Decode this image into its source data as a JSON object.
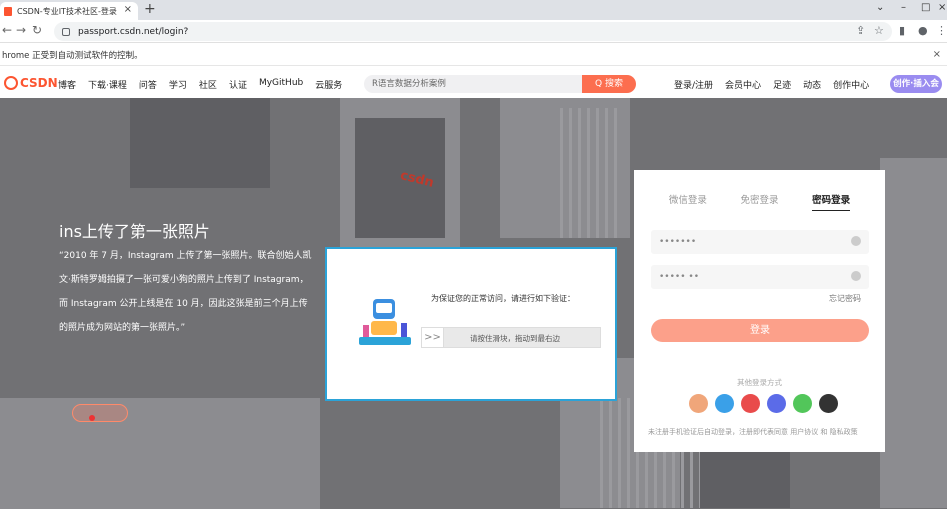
{
  "browser": {
    "tab_title": "CSDN-专业IT技术社区-登录",
    "tab_close": "×",
    "new_tab": "+",
    "url": "passport.csdn.net/login?",
    "infobar_text": "hrome 正受到自动测试软件的控制。",
    "infobar_close": "×"
  },
  "header": {
    "logo_text": "CSDN",
    "nav": [
      "博客",
      "下载·课程",
      "问答",
      "学习",
      "社区",
      "认证",
      "MyGitHub",
      "云服务"
    ],
    "search_placeholder": "R语言数据分析案例",
    "search_button": "Q 搜索",
    "right_links": [
      "登录/注册",
      "会员中心",
      "足迹",
      "动态",
      "创作中心"
    ],
    "create_button": "创作·插入会"
  },
  "hero": {
    "title": "ins上传了第一张照片",
    "paragraph": "“2010 年 7 月，Instagram 上传了第一张照片。联合创始人凯文·斯特罗姆拍摄了一张可爱小狗的照片上传到了 Instagram，而 Instagram 公开上线是在 10 月，因此这张是前三个月上传的照片成为网站的第一张照片。”",
    "banner_word": "csdn"
  },
  "login": {
    "tabs": [
      "微信登录",
      "免密登录",
      "密码登录"
    ],
    "username_value": "•••••••",
    "password_value": "••••• ••",
    "forgot": "忘记密码",
    "login_button": "登录",
    "other_methods": "其他登录方式",
    "terms": "未注册手机验证后自动登录，注册即代表同意 用户协议 和 隐私政策"
  },
  "captcha": {
    "prompt": "为保证您的正常访问，请进行如下验证：",
    "slider_text": "请按住滑块，拖动到最右边",
    "handle": ">>"
  },
  "colors": {
    "brand": "#fc5531",
    "captcha_border": "#2ba3d8"
  }
}
